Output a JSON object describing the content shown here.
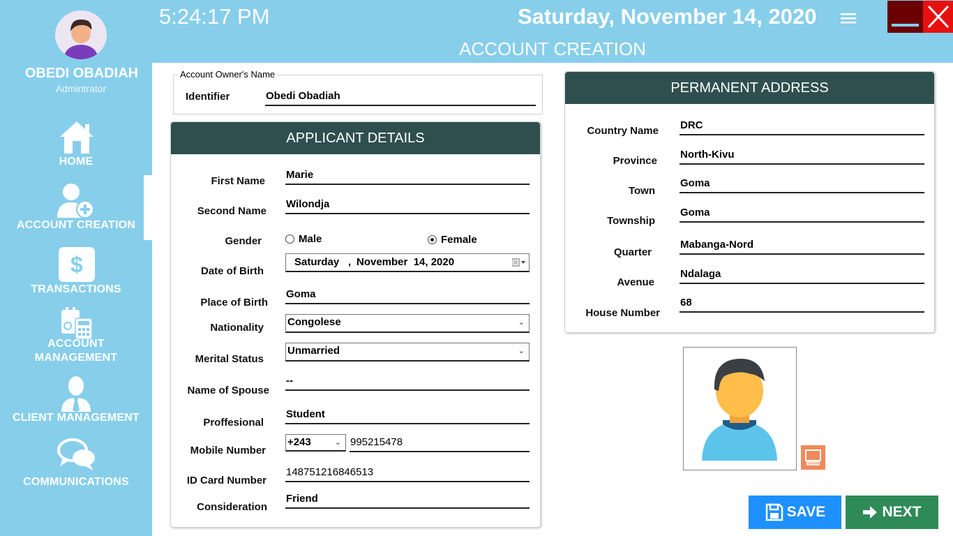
{
  "header": {
    "time": "5:24:17 PM",
    "date": "Saturday, November 14, 2020",
    "page_title": "ACCOUNT CREATION"
  },
  "user": {
    "name": "OBEDI OBADIAH",
    "role": "Admintrator"
  },
  "sidebar": {
    "items": [
      {
        "label": "HOME",
        "icon": "home-icon"
      },
      {
        "label": "ACCOUNT CREATION",
        "icon": "add-user-icon",
        "active": true
      },
      {
        "label": "TRANSACTIONS",
        "icon": "dollar-icon"
      },
      {
        "label_line1": "ACCOUNT",
        "label_line2": "MANAGEMENT",
        "icon": "calculator-icon"
      },
      {
        "label": "CLIENT MANAGEMENT",
        "icon": "client-icon"
      },
      {
        "label": "COMMUNICATIONS",
        "icon": "chat-icon"
      }
    ]
  },
  "owner": {
    "legend": "Account Owner's Name",
    "identifier_label": "Identifier",
    "identifier_value": "Obedi Obadiah"
  },
  "applicant": {
    "title": "APPLICANT DETAILS",
    "first_name_label": "First Name",
    "first_name": "Marie",
    "second_name_label": "Second Name",
    "second_name": "Wilondja",
    "gender_label": "Gender",
    "gender_male": "Male",
    "gender_female": "Female",
    "gender_selected": "Female",
    "dob_label": "Date of Birth",
    "dob_day": "Saturday",
    "dob_sep": ",",
    "dob_date": "November  14, 2020",
    "pob_label": "Place of Birth",
    "pob": "Goma",
    "nationality_label": "Nationality",
    "nationality": "Congolese",
    "marital_label": "Merital Status",
    "marital": "Unmarried",
    "spouse_label": "Name of Spouse",
    "spouse": "--",
    "profession_label": "Proffesional",
    "profession": "Student",
    "mobile_label": "Mobile Number",
    "mobile_code": "+243",
    "mobile": "995215478",
    "idcard_label": "ID Card Number",
    "idcard": "148751216846513",
    "consideration_label": "Consideration",
    "consideration": "Friend"
  },
  "address": {
    "title": "PERMANENT ADDRESS",
    "country_label": "Country Name",
    "country": "DRC",
    "province_label": "Province",
    "province": "North-Kivu",
    "town_label": "Town",
    "town": "Goma",
    "township_label": "Township",
    "township": "Goma",
    "quarter_label": "Quarter",
    "quarter": "Mabanga-Nord",
    "avenue_label": "Avenue",
    "avenue": "Ndalaga",
    "house_label": "House Number",
    "house": "68"
  },
  "actions": {
    "save": "SAVE",
    "next": "NEXT"
  },
  "colors": {
    "sidebar_bg": "#87CEEB",
    "panel_header": "#2f4f4f",
    "save_button": "#1e90ff",
    "next_button": "#2e8b57",
    "close_button": "#e8100f",
    "minimize_button": "#6b0000",
    "camera_button": "#f08a5d"
  }
}
